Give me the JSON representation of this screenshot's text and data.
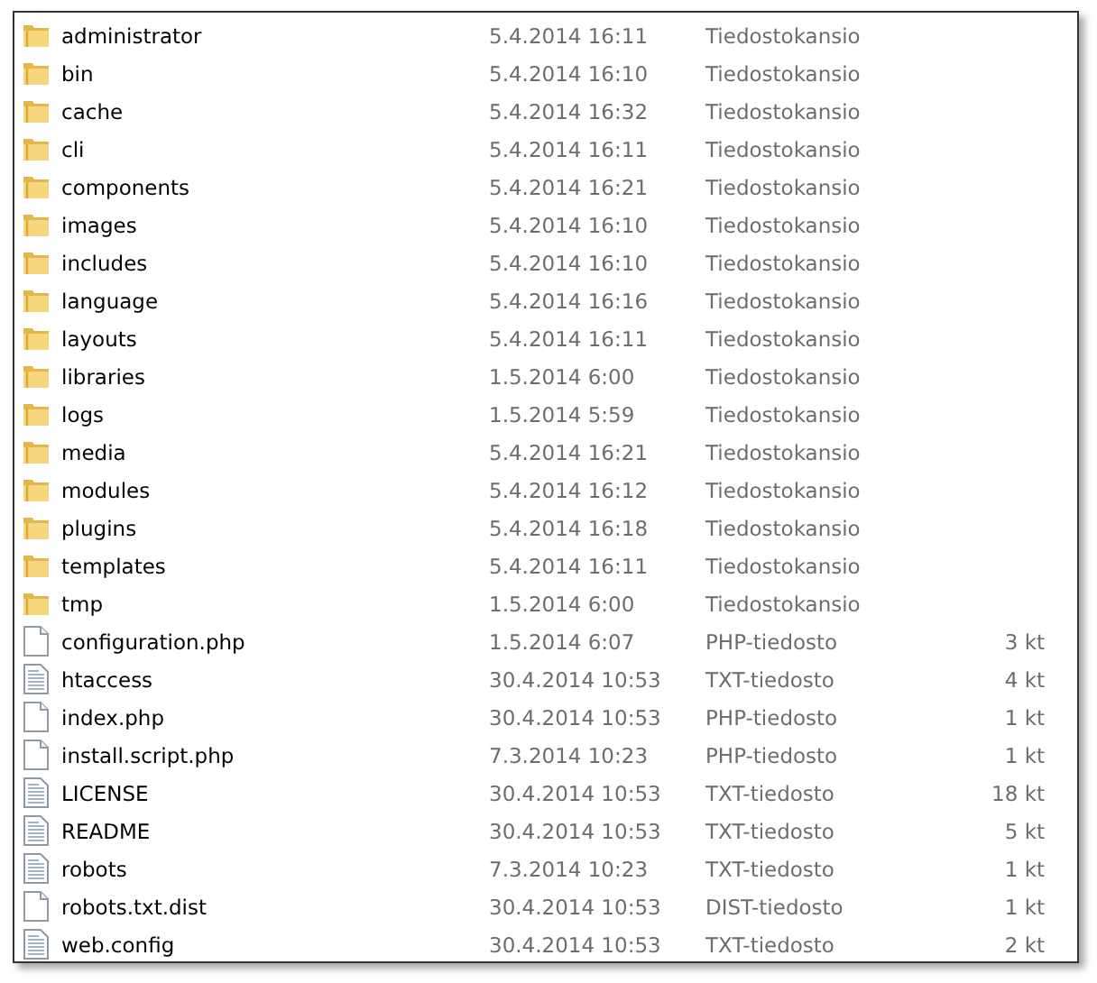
{
  "files": [
    {
      "kind": "folder",
      "name": "administrator",
      "date": "5.4.2014 16:11",
      "type": "Tiedostokansio"
    },
    {
      "kind": "folder",
      "name": "bin",
      "date": "5.4.2014 16:10",
      "type": "Tiedostokansio"
    },
    {
      "kind": "folder",
      "name": "cache",
      "date": "5.4.2014 16:32",
      "type": "Tiedostokansio"
    },
    {
      "kind": "folder",
      "name": "cli",
      "date": "5.4.2014 16:11",
      "type": "Tiedostokansio"
    },
    {
      "kind": "folder",
      "name": "components",
      "date": "5.4.2014 16:21",
      "type": "Tiedostokansio"
    },
    {
      "kind": "folder",
      "name": "images",
      "date": "5.4.2014 16:10",
      "type": "Tiedostokansio"
    },
    {
      "kind": "folder",
      "name": "includes",
      "date": "5.4.2014 16:10",
      "type": "Tiedostokansio"
    },
    {
      "kind": "folder",
      "name": "language",
      "date": "5.4.2014 16:16",
      "type": "Tiedostokansio"
    },
    {
      "kind": "folder",
      "name": "layouts",
      "date": "5.4.2014 16:11",
      "type": "Tiedostokansio"
    },
    {
      "kind": "folder",
      "name": "libraries",
      "date": "1.5.2014 6:00",
      "type": "Tiedostokansio"
    },
    {
      "kind": "folder",
      "name": "logs",
      "date": "1.5.2014 5:59",
      "type": "Tiedostokansio"
    },
    {
      "kind": "folder",
      "name": "media",
      "date": "5.4.2014 16:21",
      "type": "Tiedostokansio"
    },
    {
      "kind": "folder",
      "name": "modules",
      "date": "5.4.2014 16:12",
      "type": "Tiedostokansio"
    },
    {
      "kind": "folder",
      "name": "plugins",
      "date": "5.4.2014 16:18",
      "type": "Tiedostokansio"
    },
    {
      "kind": "folder",
      "name": "templates",
      "date": "5.4.2014 16:11",
      "type": "Tiedostokansio"
    },
    {
      "kind": "folder",
      "name": "tmp",
      "date": "1.5.2014 6:00",
      "type": "Tiedostokansio"
    },
    {
      "kind": "file",
      "name": "configuration.php",
      "date": "1.5.2014 6:07",
      "type": "PHP-tiedosto",
      "size": "3 kt"
    },
    {
      "kind": "text",
      "name": "htaccess",
      "date": "30.4.2014 10:53",
      "type": "TXT-tiedosto",
      "size": "4 kt"
    },
    {
      "kind": "file",
      "name": "index.php",
      "date": "30.4.2014 10:53",
      "type": "PHP-tiedosto",
      "size": "1 kt"
    },
    {
      "kind": "file",
      "name": "install.script.php",
      "date": "7.3.2014 10:23",
      "type": "PHP-tiedosto",
      "size": "1 kt"
    },
    {
      "kind": "text",
      "name": "LICENSE",
      "date": "30.4.2014 10:53",
      "type": "TXT-tiedosto",
      "size": "18 kt"
    },
    {
      "kind": "text",
      "name": "README",
      "date": "30.4.2014 10:53",
      "type": "TXT-tiedosto",
      "size": "5 kt"
    },
    {
      "kind": "text",
      "name": "robots",
      "date": "7.3.2014 10:23",
      "type": "TXT-tiedosto",
      "size": "1 kt"
    },
    {
      "kind": "file",
      "name": "robots.txt.dist",
      "date": "30.4.2014 10:53",
      "type": "DIST-tiedosto",
      "size": "1 kt"
    },
    {
      "kind": "text",
      "name": "web.config",
      "date": "30.4.2014 10:53",
      "type": "TXT-tiedosto",
      "size": "2 kt"
    }
  ]
}
